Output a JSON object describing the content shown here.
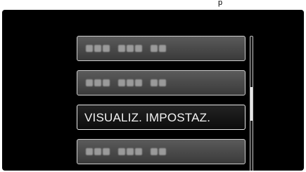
{
  "screen": {
    "header_text": "p",
    "menu": {
      "items": [
        {
          "label": "",
          "state": "obscured"
        },
        {
          "label": "",
          "state": "obscured"
        },
        {
          "label": "VISUALIZ. IMPOSTAZ.",
          "state": "selected"
        },
        {
          "label": "",
          "state": "obscured"
        }
      ]
    },
    "scrollbar": {
      "position_fraction": 0.5,
      "visible_fraction": 0.25
    }
  }
}
